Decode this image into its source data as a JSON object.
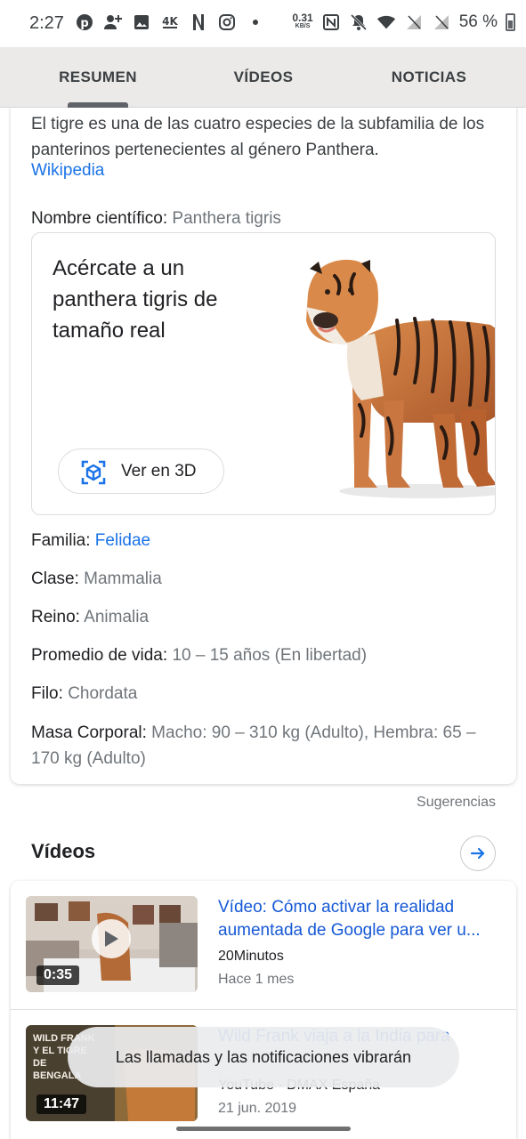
{
  "status_bar": {
    "time": "2:27",
    "net_speed_value": "0.31",
    "net_speed_unit": "KB/S",
    "battery": "56 %",
    "icons_left": [
      "pinterest-icon",
      "add-person-icon",
      "image-icon",
      "4k-icon",
      "netflix-icon",
      "instagram-icon",
      "dot-icon"
    ],
    "icons_right": [
      "nfc-icon",
      "bell-off-icon",
      "wifi-icon",
      "signal-off-icon",
      "signal-off-icon",
      "battery-icon"
    ]
  },
  "tabs": [
    {
      "label": "RESUMEN",
      "active": true
    },
    {
      "label": "VÍDEOS",
      "active": false
    },
    {
      "label": "NOTICIAS",
      "active": false
    }
  ],
  "summary": {
    "description": "El tigre es una de las cuatro especies de la subfamilia de los panterinos pertenecientes al género Panthera.",
    "source_link": "Wikipedia"
  },
  "scientific_name": {
    "label": "Nombre científico:",
    "value": "Panthera tigris"
  },
  "ar_card": {
    "title": "Acércate a un panthera tigris de tamaño real",
    "button_label": "Ver en 3D"
  },
  "facts": [
    {
      "label": "Familia:",
      "value": "Felidae",
      "is_link": true
    },
    {
      "label": "Clase:",
      "value": "Mammalia",
      "is_link": false
    },
    {
      "label": "Reino:",
      "value": "Animalia",
      "is_link": false
    },
    {
      "label": "Promedio de vida:",
      "value": "10 – 15 años (En libertad)",
      "is_link": false
    },
    {
      "label": "Filo:",
      "value": "Chordata",
      "is_link": false
    },
    {
      "label": "Masa Corporal:",
      "value": "Macho: 90 – 310 kg (Adulto), Hembra: 65 – 170 kg (Adulto)",
      "is_link": false
    }
  ],
  "suggestions_label": "Sugerencias",
  "videos": {
    "heading": "Vídeos",
    "items": [
      {
        "title": "Vídeo: Cómo activar la realidad aumentada de Google para ver u...",
        "source": "20Minutos",
        "date": "Hace 1 mes",
        "duration": "0:35"
      },
      {
        "title": "Wild Frank viaja a la India para",
        "source": "YouTube · DMAX España",
        "date": "21 jun. 2019",
        "duration": "11:47",
        "thumb_text": "WILD FRANK Y EL TIGRE DE BENGALA"
      }
    ]
  },
  "toast": "Las llamadas y las notificaciones vibrarán",
  "colors": {
    "link": "#1a73e8",
    "tab_bg": "#ebeae8",
    "muted": "#70757a"
  }
}
